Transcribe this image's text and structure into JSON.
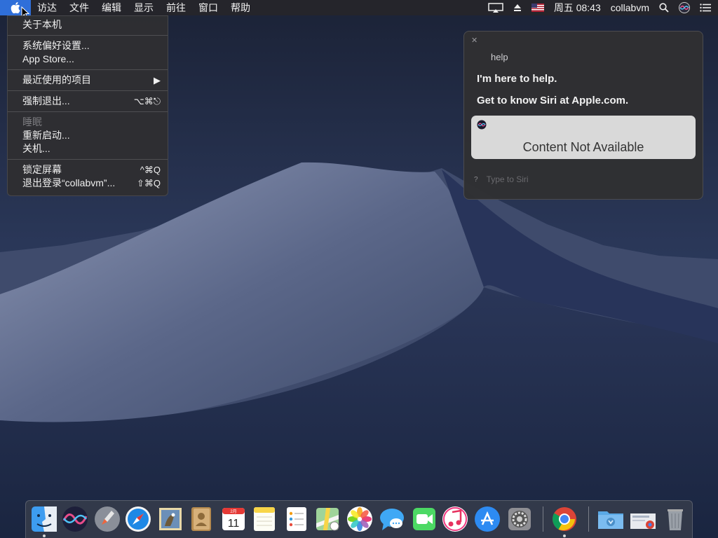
{
  "menubar": {
    "menus": [
      "访达",
      "文件",
      "编辑",
      "显示",
      "前往",
      "窗口",
      "帮助"
    ],
    "clock": "周五 08:43",
    "user": "collabvm"
  },
  "apple_menu": {
    "about": "关于本机",
    "sysprefs": "系统偏好设置...",
    "appstore": "App Store...",
    "recent": "最近使用的项目",
    "force_quit": "强制退出...",
    "force_quit_shortcut": "⌥⌘⎋",
    "sleep": "睡眠",
    "restart": "重新启动...",
    "shutdown": "关机...",
    "lock": "锁定屏幕",
    "lock_shortcut": "^⌘Q",
    "logout": "退出登录“collabvm”...",
    "logout_shortcut": "⇧⌘Q"
  },
  "siri": {
    "query": "help",
    "line1": "I'm here to help.",
    "line2": "Get to know Siri at Apple.com.",
    "card_message": "Content Not Available",
    "type_placeholder": "Type to Siri"
  },
  "dock": {
    "calendar_month": "2月",
    "calendar_day": "11",
    "apps": [
      "finder",
      "siri",
      "launchpad",
      "safari",
      "mail",
      "contacts",
      "calendar",
      "notes",
      "reminders",
      "maps",
      "photos",
      "messages",
      "facetime",
      "itunes",
      "app-store",
      "system-preferences",
      "chrome",
      "downloads",
      "document",
      "trash"
    ]
  },
  "colors": {
    "menu_highlight": "#2f6fd9",
    "menubar_bg": "#26262a",
    "siri_card": "#d9d9d9"
  }
}
